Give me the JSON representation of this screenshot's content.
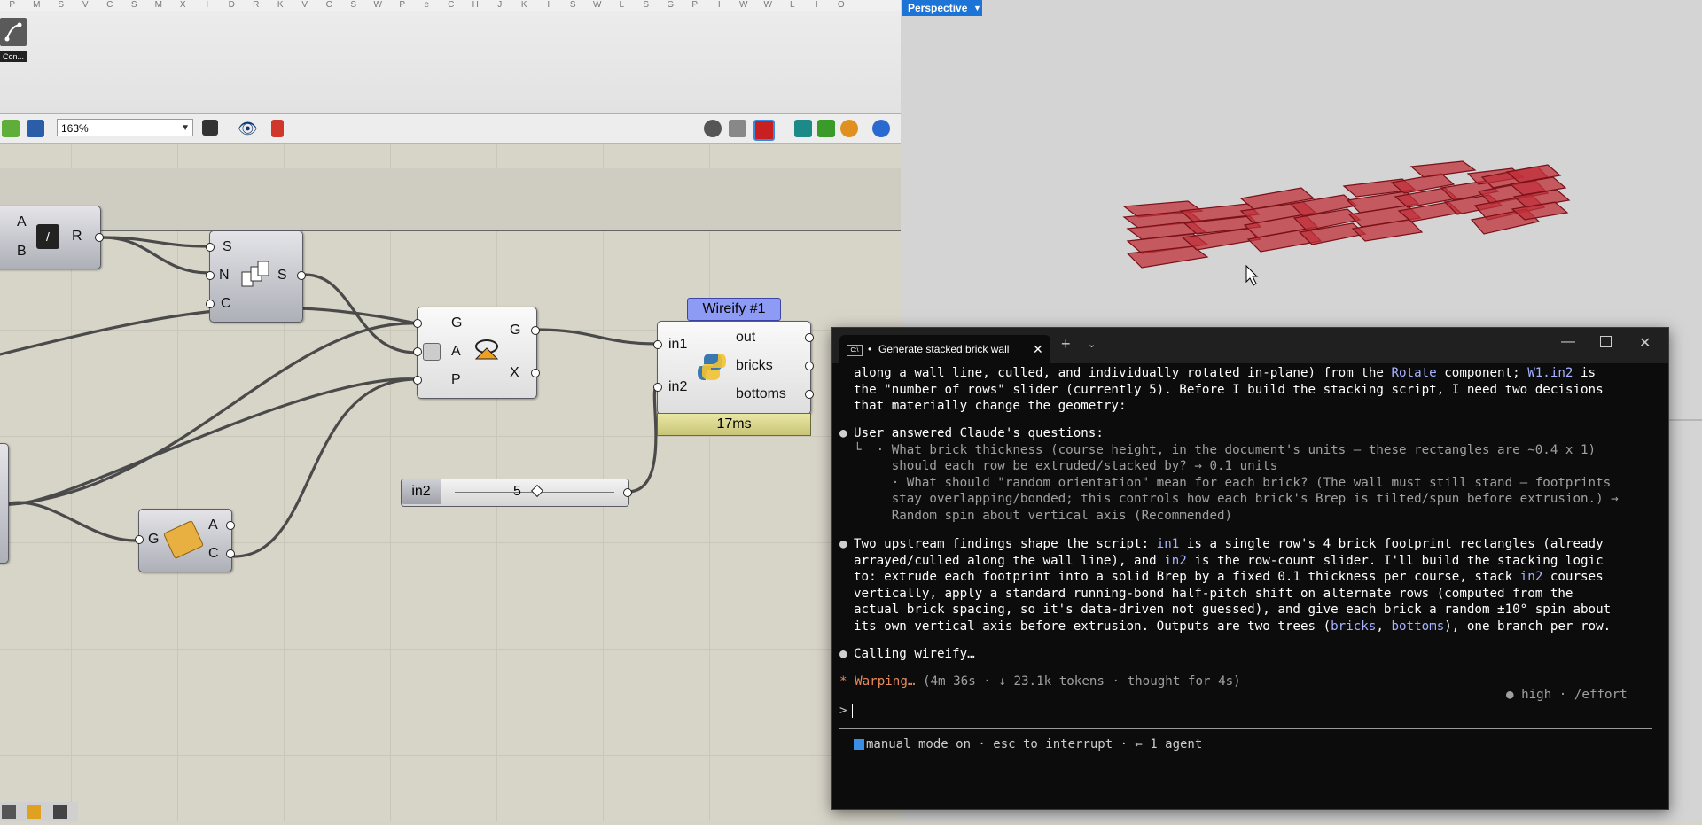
{
  "ribbon": {
    "letters": [
      "P",
      "M",
      "S",
      "V",
      "C",
      "S",
      "M",
      "X",
      "I",
      "D",
      "R",
      "K",
      "V",
      "C",
      "S",
      "W",
      "P",
      "e",
      "C",
      "H",
      "J",
      "K",
      "I",
      "S",
      "W",
      "L",
      "S",
      "G",
      "P",
      "I",
      "W",
      "W",
      "L",
      "I",
      "O"
    ],
    "component_label": "Con..."
  },
  "toolbar": {
    "zoom_value": "163%"
  },
  "canvas": {
    "components": {
      "division": {
        "inputs": [
          "A",
          "B"
        ],
        "outputs": [
          "R"
        ]
      },
      "series": {
        "inputs": [
          "S",
          "N",
          "C"
        ],
        "outputs": [
          "S"
        ]
      },
      "rotate": {
        "inputs": [
          "G",
          "A",
          "P"
        ],
        "outputs": [
          "G",
          "X"
        ]
      },
      "wireify": {
        "title": "Wireify #1",
        "inputs": [
          "in1",
          "in2"
        ],
        "outputs": [
          "out",
          "bricks",
          "bottoms"
        ],
        "timer": "17ms"
      },
      "old": {
        "inputs": [
          "G"
        ],
        "outputs": [
          "A",
          "C"
        ]
      }
    },
    "slider": {
      "name": "in2",
      "value": "5"
    }
  },
  "viewport": {
    "label": "Perspective",
    "colors": {
      "brick_fill": "#c0303a",
      "brick_stroke": "#8a1018"
    }
  },
  "terminal": {
    "tab_title": "Generate stacked brick wall",
    "lines": {
      "l1a": "along a wall line, culled, and individually rotated in-plane) from the ",
      "l1b": "Rotate",
      "l1c": " component; ",
      "l1d": "W1.in2",
      "l1e": " is",
      "l2": "the \"number of rows\" slider (currently 5). Before I build the stacking script, I need two decisions",
      "l3": "that materially change the geometry:",
      "q_head": "User answered Claude's questions:",
      "q1": "└  · What brick thickness (course height, in the document's units — these rectangles are ~0.4 x 1)",
      "q2": "     should each row be extruded/stacked by? → 0.1 units",
      "q3": "     · What should \"random orientation\" mean for each brick? (The wall must still stand — footprints",
      "q4": "     stay overlapping/bonded; this controls how each brick's Brep is tilted/spun before extrusion.) →",
      "q5": "     Random spin about vertical axis (Recommended)",
      "f1a": "Two upstream findings shape the script: ",
      "f1b": "in1",
      "f1c": " is a single row's 4 brick footprint rectangles (already",
      "f2a": "arrayed/culled along the wall line), and ",
      "f2b": "in2",
      "f2c": " is the row-count slider. I'll build the stacking logic",
      "f3a": "to: extrude each footprint into a solid Brep by a fixed 0.1 thickness per course, stack ",
      "f3b": "in2",
      "f3c": " courses",
      "f4": "vertically, apply a standard running-bond half-pitch shift on alternate rows (computed from the",
      "f5": "actual brick spacing, so it's data-driven not guessed), and give each brick a random ±10° spin about",
      "f6a": "its own vertical axis before extrusion. Outputs are two trees (",
      "f6b": "bricks",
      "f6c": ", ",
      "f6d": "bottoms",
      "f6e": "), one branch per row.",
      "calling": "Calling wireify…",
      "status_word": "* Warping…",
      "status_rest": " (4m 36s · ↓ 23.1k tokens · thought for 4s)",
      "effort": "● high · /effort",
      "prompt": ">",
      "footer": "manual mode on · esc to interrupt · ← 1 agent"
    },
    "bullet": "●"
  }
}
